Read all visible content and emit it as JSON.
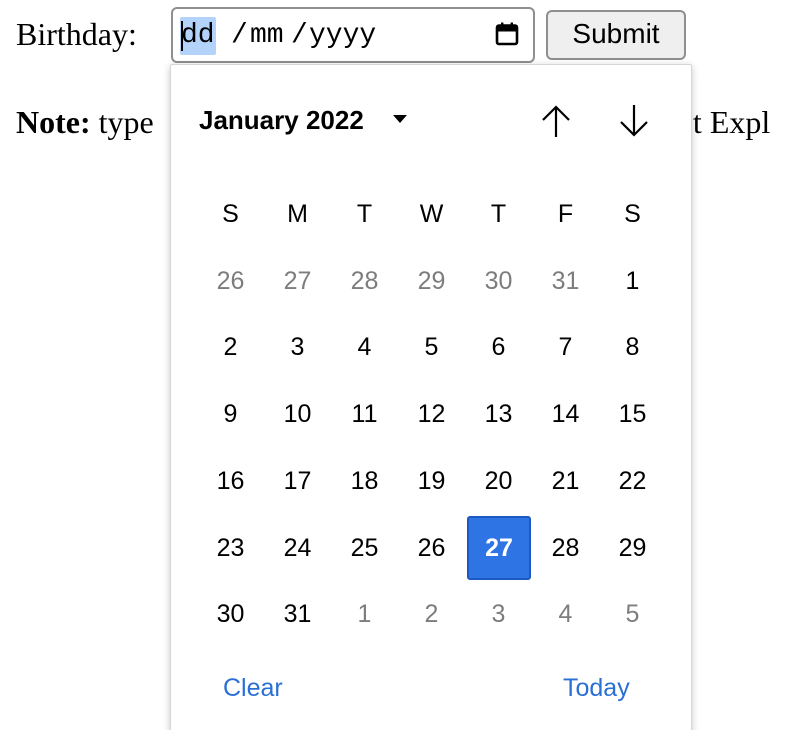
{
  "form": {
    "birthday_label": "Birthday:",
    "date_input": {
      "day_placeholder": "dd",
      "separator": "/",
      "month_placeholder": "mm",
      "year_placeholder": "yyyy"
    },
    "submit_label": "Submit"
  },
  "note": {
    "strong": "Note:",
    "text_left": "type",
    "text_right": "et Expl"
  },
  "calendar": {
    "month_label": "January 2022",
    "weekdays": [
      "S",
      "M",
      "T",
      "W",
      "T",
      "F",
      "S"
    ],
    "weeks": [
      [
        {
          "d": "26",
          "other": true
        },
        {
          "d": "27",
          "other": true
        },
        {
          "d": "28",
          "other": true
        },
        {
          "d": "29",
          "other": true
        },
        {
          "d": "30",
          "other": true
        },
        {
          "d": "31",
          "other": true
        },
        {
          "d": "1",
          "other": false
        }
      ],
      [
        {
          "d": "2",
          "other": false
        },
        {
          "d": "3",
          "other": false
        },
        {
          "d": "4",
          "other": false
        },
        {
          "d": "5",
          "other": false
        },
        {
          "d": "6",
          "other": false
        },
        {
          "d": "7",
          "other": false
        },
        {
          "d": "8",
          "other": false
        }
      ],
      [
        {
          "d": "9",
          "other": false
        },
        {
          "d": "10",
          "other": false
        },
        {
          "d": "11",
          "other": false
        },
        {
          "d": "12",
          "other": false
        },
        {
          "d": "13",
          "other": false
        },
        {
          "d": "14",
          "other": false
        },
        {
          "d": "15",
          "other": false
        }
      ],
      [
        {
          "d": "16",
          "other": false
        },
        {
          "d": "17",
          "other": false
        },
        {
          "d": "18",
          "other": false
        },
        {
          "d": "19",
          "other": false
        },
        {
          "d": "20",
          "other": false
        },
        {
          "d": "21",
          "other": false
        },
        {
          "d": "22",
          "other": false
        }
      ],
      [
        {
          "d": "23",
          "other": false
        },
        {
          "d": "24",
          "other": false
        },
        {
          "d": "25",
          "other": false
        },
        {
          "d": "26",
          "other": false
        },
        {
          "d": "27",
          "other": false,
          "selected": true
        },
        {
          "d": "28",
          "other": false
        },
        {
          "d": "29",
          "other": false
        }
      ],
      [
        {
          "d": "30",
          "other": false
        },
        {
          "d": "31",
          "other": false
        },
        {
          "d": "1",
          "other": true
        },
        {
          "d": "2",
          "other": true
        },
        {
          "d": "3",
          "other": true
        },
        {
          "d": "4",
          "other": true
        },
        {
          "d": "5",
          "other": true
        }
      ]
    ],
    "clear_label": "Clear",
    "today_label": "Today"
  },
  "icons": {
    "calendar": "calendar-icon",
    "month_dropdown": "caret-down-icon",
    "prev": "arrow-up-icon",
    "next": "arrow-down-icon"
  },
  "colors": {
    "selected_day": "#2f74e4",
    "link": "#2a6fd3",
    "input_highlight": "#b4d3fb",
    "other_month_day": "#7d7d7d"
  }
}
